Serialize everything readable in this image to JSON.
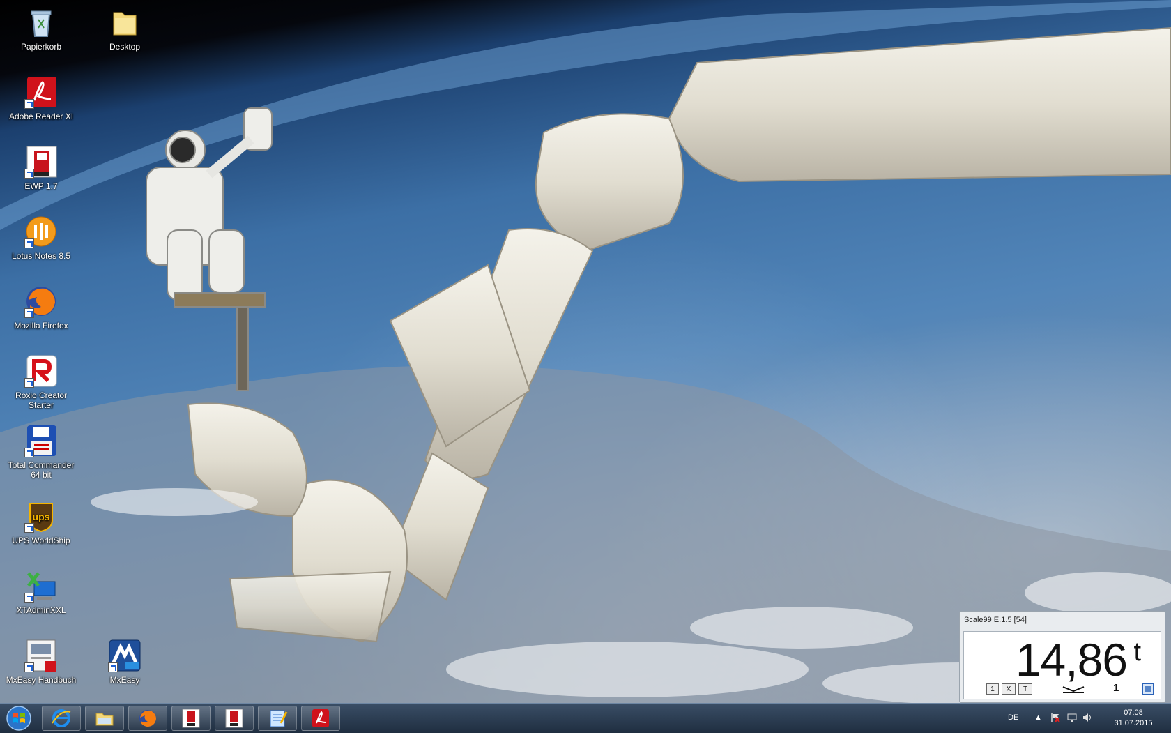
{
  "desktop": {
    "icons": [
      {
        "label": "Papierkorb",
        "icon": "recycle-bin-icon"
      },
      {
        "label": "Desktop",
        "icon": "folder-icon"
      },
      {
        "label": "Adobe Reader XI",
        "icon": "adobe-reader-icon"
      },
      {
        "label": "EWP 1.7",
        "icon": "ewp-icon"
      },
      {
        "label": "Lotus Notes 8.5",
        "icon": "lotus-notes-icon"
      },
      {
        "label": "Mozilla Firefox",
        "icon": "firefox-icon"
      },
      {
        "label": "Roxio Creator Starter",
        "icon": "roxio-icon"
      },
      {
        "label": "Total Commander 64 bit",
        "icon": "total-commander-icon"
      },
      {
        "label": "UPS WorldShip",
        "icon": "ups-icon"
      },
      {
        "label": "XTAdminXXL",
        "icon": "xtadmin-icon"
      },
      {
        "label": "MxEasy Handbuch",
        "icon": "mxeasy-handbuch-icon"
      },
      {
        "label": "MxEasy",
        "icon": "mxeasy-icon"
      }
    ],
    "colors": {
      "sky": "#3c6fa5",
      "space": "#000000",
      "arm": "#e6e2d6"
    }
  },
  "widget": {
    "title": "Scale99 E.1.5 [54]",
    "value": "14,86",
    "unit": "t",
    "button1": "1",
    "button2": "X",
    "button3": "T",
    "count": "1"
  },
  "taskbar": {
    "buttons": [
      "start-orb-icon",
      "internet-explorer-icon",
      "file-explorer-icon",
      "firefox-icon",
      "ewp-icon",
      "ewp-icon",
      "notepad-icon",
      "adobe-reader-icon"
    ],
    "tray": {
      "language": "DE",
      "time": "07:08",
      "date": "31.07.2015"
    }
  }
}
